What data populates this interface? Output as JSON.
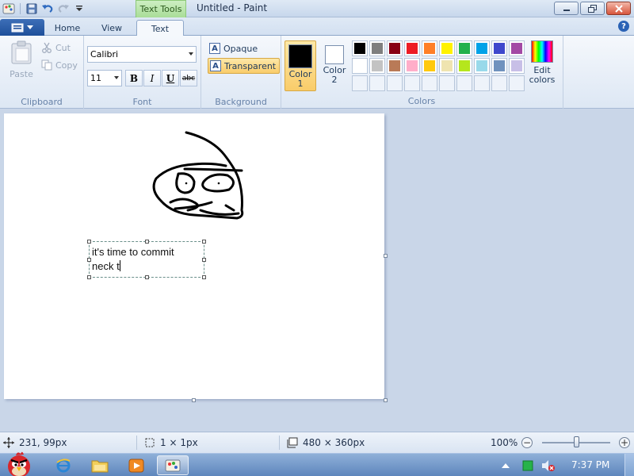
{
  "window": {
    "title": "Untitled - Paint",
    "contextual_tab_title": "Text Tools"
  },
  "tabs": {
    "home": "Home",
    "view": "View",
    "text": "Text"
  },
  "clipboard": {
    "paste": "Paste",
    "cut": "Cut",
    "copy": "Copy",
    "label": "Clipboard"
  },
  "font": {
    "family": "Calibri",
    "size": "11",
    "bold": "B",
    "italic": "I",
    "underline": "U",
    "strike": "abc",
    "label": "Font"
  },
  "background": {
    "opaque": "Opaque",
    "transparent": "Transparent",
    "label": "Background"
  },
  "colors": {
    "color1_label": "Color\n1",
    "color2_label": "Color\n2",
    "color1": "#000000",
    "color2": "#ffffff",
    "edit": "Edit\ncolors",
    "label": "Colors",
    "palette": [
      "#000000",
      "#7f7f7f",
      "#880015",
      "#ed1c24",
      "#ff7f27",
      "#fff200",
      "#22b14c",
      "#00a2e8",
      "#3f48cc",
      "#a349a4",
      "#ffffff",
      "#c3c3c3",
      "#b97a57",
      "#ffaec9",
      "#ffc90e",
      "#efe4b0",
      "#b5e61d",
      "#99d9ea",
      "#7092be",
      "#c8bfe7"
    ],
    "custom_slots": 10
  },
  "canvas": {
    "text_line1": "it's time to commit",
    "text_line2": "neck t"
  },
  "status": {
    "cursor": "231, 99px",
    "selection": "1 × 1px",
    "canvas_size": "480 × 360px",
    "zoom": "100%",
    "zoom_level": 100
  },
  "taskbar": {
    "clock": "7:37 PM"
  }
}
